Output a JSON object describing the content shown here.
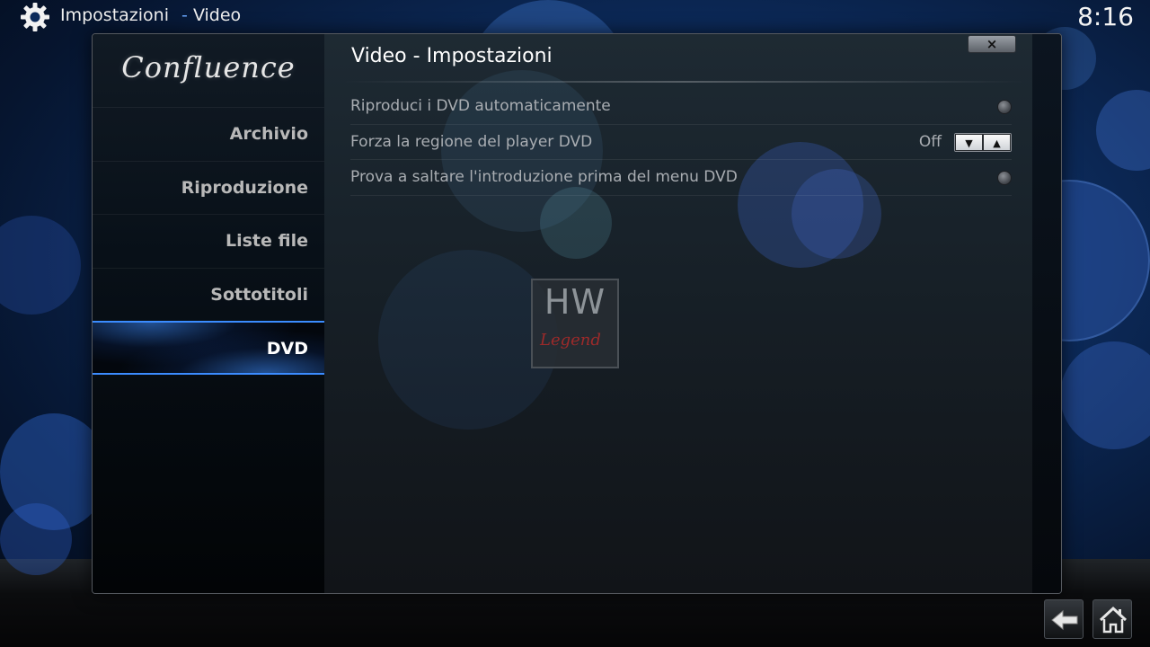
{
  "header": {
    "section": "Impostazioni",
    "separator": "-",
    "subsection": "Video",
    "clock": "8:16"
  },
  "sidebar": {
    "logo": "Confluence",
    "items": [
      {
        "label": "Archivio",
        "active": false
      },
      {
        "label": "Riproduzione",
        "active": false
      },
      {
        "label": "Liste file",
        "active": false
      },
      {
        "label": "Sottotitoli",
        "active": false
      },
      {
        "label": "DVD",
        "active": true
      }
    ]
  },
  "content": {
    "title": "Video - Impostazioni",
    "close_icon": "×",
    "settings": [
      {
        "label": "Riproduci i DVD automaticamente",
        "control": "radio"
      },
      {
        "label": "Forza la regione del player DVD",
        "control": "spin",
        "value": "Off"
      },
      {
        "label": "Prova a saltare l'introduzione prima del menu DVD",
        "control": "radio"
      }
    ],
    "watermark": {
      "top": "HW",
      "bottom": "Legend"
    }
  },
  "icons": {
    "gear": "gear-icon",
    "back": "back-arrow-icon",
    "home": "home-icon",
    "close": "close-icon",
    "spin_down": "arrow-down-icon",
    "spin_up": "arrow-up-icon"
  },
  "colors": {
    "accent": "#3b8cff",
    "background": "#0c2a5a",
    "watermark_red": "#9c2a2a"
  }
}
